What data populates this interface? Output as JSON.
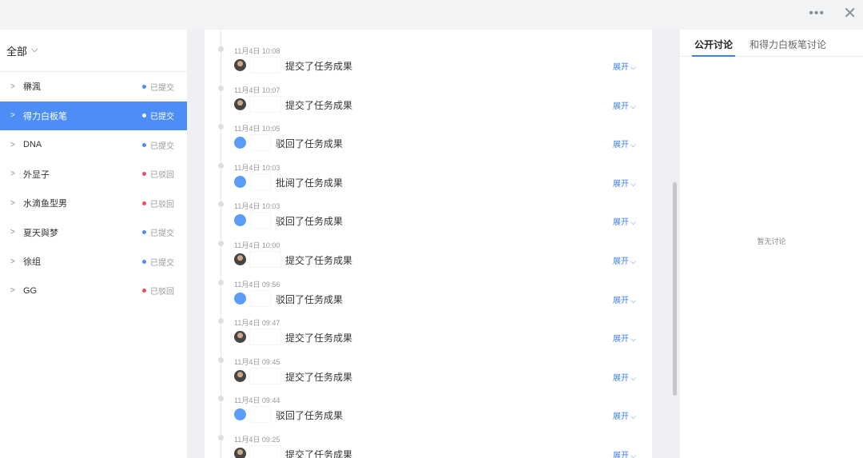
{
  "window": {
    "more_icon": "more-horizontal-icon",
    "close_icon": "close-icon",
    "more_glyph": "•••",
    "close_glyph": "✕"
  },
  "sidebar": {
    "filter_label": "全部",
    "filter_chevron": "⌵",
    "items": [
      {
        "name": "楙渢",
        "status": "已提交",
        "status_color": "#4c8ef5",
        "active": false
      },
      {
        "name": "得力白板笔",
        "status": "已提交",
        "status_color": "#ffffff",
        "active": true
      },
      {
        "name": "DNA",
        "status": "已提交",
        "status_color": "#4c8ef5",
        "active": false
      },
      {
        "name": "外显子",
        "status": "已驳回",
        "status_color": "#e8505b",
        "active": false
      },
      {
        "name": "水滴鱼型男",
        "status": "已驳回",
        "status_color": "#e8505b",
        "active": false
      },
      {
        "name": "夏天與梦",
        "status": "已提交",
        "status_color": "#4c8ef5",
        "active": false
      },
      {
        "name": "徐组",
        "status": "已提交",
        "status_color": "#4c8ef5",
        "active": false
      },
      {
        "name": "GG",
        "status": "已驳回",
        "status_color": "#e8505b",
        "active": false
      }
    ]
  },
  "timeline": {
    "expand_label": "展开",
    "entries": [
      {
        "time": "11月4日 10:08",
        "avatar": "photo",
        "action": "提交了任务成果"
      },
      {
        "time": "11月4日 10:07",
        "avatar": "photo",
        "action": "提交了任务成果"
      },
      {
        "time": "11月4日 10:05",
        "avatar": "badge",
        "action": "驳回了任务成果"
      },
      {
        "time": "11月4日 10:03",
        "avatar": "badge",
        "action": "批阅了任务成果"
      },
      {
        "time": "11月4日 10:03",
        "avatar": "badge",
        "action": "驳回了任务成果"
      },
      {
        "time": "11月4日 10:00",
        "avatar": "photo",
        "action": "提交了任务成果"
      },
      {
        "time": "11月4日 09:56",
        "avatar": "badge",
        "action": "驳回了任务成果"
      },
      {
        "time": "11月4日 09:47",
        "avatar": "photo",
        "action": "提交了任务成果"
      },
      {
        "time": "11月4日 09:45",
        "avatar": "photo",
        "action": "提交了任务成果"
      },
      {
        "time": "11月4日 09:44",
        "avatar": "badge",
        "action": "驳回了任务成果"
      },
      {
        "time": "11月4日 09:25",
        "avatar": "photo",
        "action": "提交了任务成果"
      }
    ]
  },
  "discussion": {
    "tabs": [
      "公开讨论",
      "和得力白板笔讨论"
    ],
    "empty_text": "暂无讨论"
  },
  "colors": {
    "accent": "#3c7ff0",
    "active_row": "#4c8ef5",
    "submitted": "#4c8ef5",
    "rejected": "#e8505b"
  }
}
